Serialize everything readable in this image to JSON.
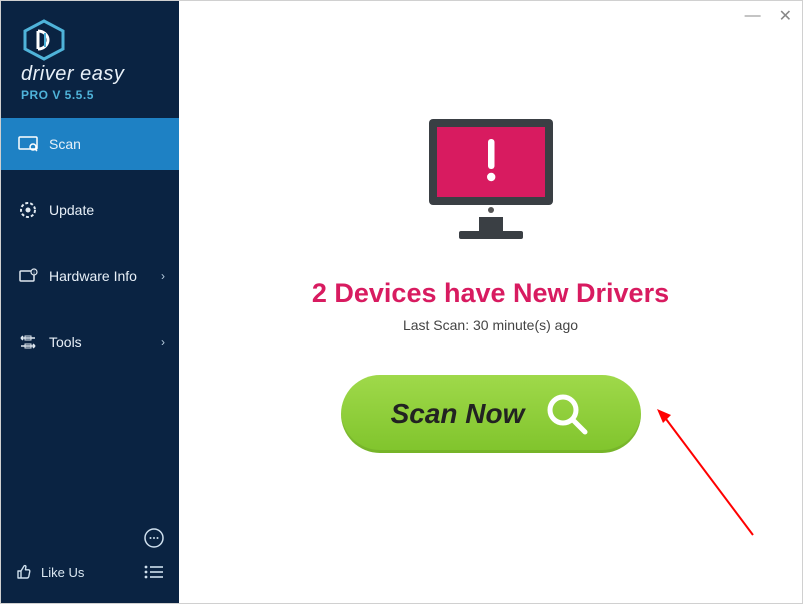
{
  "brand": {
    "name": "driver easy",
    "version_line": "PRO V 5.5.5"
  },
  "nav": {
    "scan": "Scan",
    "update": "Update",
    "hardware": "Hardware Info",
    "tools": "Tools"
  },
  "bottom": {
    "like_us": "Like Us"
  },
  "main": {
    "headline": "2 Devices have New Drivers",
    "subline": "Last Scan: 30 minute(s) ago",
    "scan_button": "Scan Now"
  },
  "colors": {
    "accent_pink": "#d81b60",
    "sidebar_bg": "#0a2342",
    "active_nav": "#1e81c4",
    "scan_green": "#8cc63f"
  }
}
